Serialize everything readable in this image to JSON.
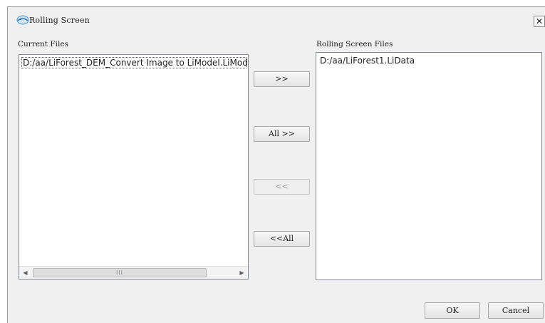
{
  "window": {
    "title": "Rolling Screen",
    "close_glyph": "✕",
    "icon": "app-logo-icon"
  },
  "left_panel": {
    "label": "Current Files",
    "items": [
      "D:/aa/LiForest_DEM_Convert Image to LiModel.LiModel"
    ],
    "scrollbar": {
      "left_arrow": "◀",
      "right_arrow": "▶",
      "grip": "III"
    }
  },
  "right_panel": {
    "label": "Rolling Screen Files",
    "items": [
      "D:/aa/LiForest1.LiData"
    ]
  },
  "transfer_buttons": {
    "move_right": ">>",
    "move_all_right": "All >>",
    "move_left": "<<",
    "move_all_left": "<<All"
  },
  "footer": {
    "ok": "OK",
    "cancel": "Cancel"
  }
}
